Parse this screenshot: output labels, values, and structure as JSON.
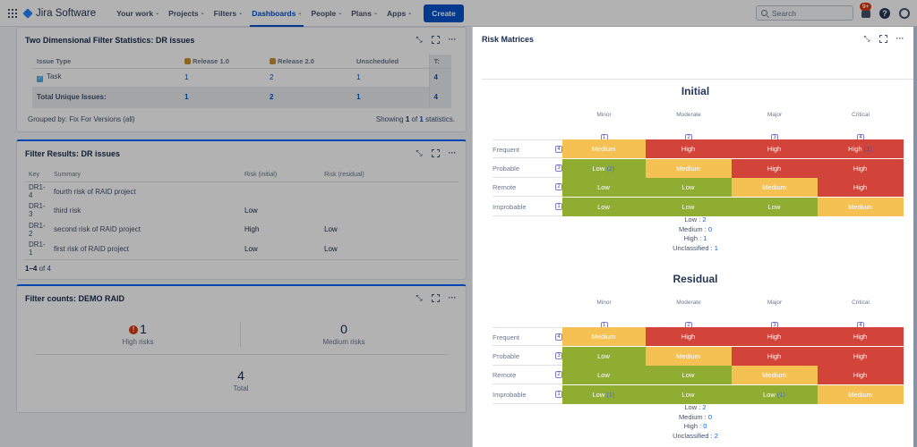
{
  "nav": {
    "app_name": "Jira Software",
    "items": [
      {
        "label": "Your work",
        "active": false
      },
      {
        "label": "Projects",
        "active": false
      },
      {
        "label": "Filters",
        "active": false
      },
      {
        "label": "Dashboards",
        "active": true
      },
      {
        "label": "People",
        "active": false
      },
      {
        "label": "Plans",
        "active": false
      },
      {
        "label": "Apps",
        "active": false
      }
    ],
    "create_label": "Create",
    "search_placeholder": "Search",
    "notifications_badge": "9+",
    "help_label": "?"
  },
  "two_dim": {
    "title": "Two Dimensional Filter Statistics: DR issues",
    "headers": [
      "Issue Type",
      "Release 1.0",
      "Release 2.0",
      "Unscheduled",
      "T:"
    ],
    "row": {
      "type": "Task",
      "values": [
        "1",
        "2",
        "1"
      ],
      "total": "4"
    },
    "total_row": {
      "label": "Total Unique Issues:",
      "values": [
        "1",
        "2",
        "1"
      ],
      "total": "4"
    },
    "grouped_by": "Grouped by: Fix For Versions (all)",
    "showing_prefix": "Showing",
    "showing_current": "1",
    "showing_of": "of",
    "showing_total": "1",
    "showing_suffix": "statistics."
  },
  "filter_results": {
    "title": "Filter Results: DR issues",
    "headers": [
      "Key",
      "Summary",
      "Risk (initial)",
      "Risk (residual)"
    ],
    "rows": [
      {
        "key": "DR1-4",
        "summary": "fourth risk of RAID project",
        "initial": "",
        "residual": ""
      },
      {
        "key": "DR1-3",
        "summary": "third risk",
        "initial": "Low",
        "residual": ""
      },
      {
        "key": "DR1-2",
        "summary": "second risk of RAID project",
        "initial": "High",
        "residual": "Low"
      },
      {
        "key": "DR1-1",
        "summary": "first risk of RAID project",
        "initial": "Low",
        "residual": "Low"
      }
    ],
    "pagination_range": "1–4",
    "pagination_of": "of",
    "pagination_total": "4"
  },
  "filter_counts": {
    "title": "Filter counts: DEMO RAID",
    "high": {
      "value": "1",
      "label": "High risks"
    },
    "medium": {
      "value": "0",
      "label": "Medium risks"
    },
    "total": {
      "value": "4",
      "label": "Total"
    }
  },
  "risk_matrices": {
    "title": "Risk Matrices",
    "columns": [
      {
        "label": "Minor",
        "index": "1"
      },
      {
        "label": "Moderate",
        "index": "2"
      },
      {
        "label": "Major",
        "index": "3"
      },
      {
        "label": "Critical",
        "index": "4"
      }
    ],
    "rows": [
      {
        "label": "Frequent",
        "index": "4"
      },
      {
        "label": "Probable",
        "index": "3"
      },
      {
        "label": "Remote",
        "index": "2"
      },
      {
        "label": "Improbable",
        "index": "1"
      }
    ],
    "matrices": [
      {
        "title": "Initial",
        "cells": [
          [
            {
              "level": "Medium",
              "count": ""
            },
            {
              "level": "High",
              "count": ""
            },
            {
              "level": "High",
              "count": ""
            },
            {
              "level": "High",
              "count": "(1)"
            }
          ],
          [
            {
              "level": "Low",
              "count": "(2)"
            },
            {
              "level": "Medium",
              "count": ""
            },
            {
              "level": "High",
              "count": ""
            },
            {
              "level": "High",
              "count": ""
            }
          ],
          [
            {
              "level": "Low",
              "count": ""
            },
            {
              "level": "Low",
              "count": ""
            },
            {
              "level": "Medium",
              "count": ""
            },
            {
              "level": "High",
              "count": ""
            }
          ],
          [
            {
              "level": "Low",
              "count": ""
            },
            {
              "level": "Low",
              "count": ""
            },
            {
              "level": "Low",
              "count": ""
            },
            {
              "level": "Medium",
              "count": ""
            }
          ]
        ],
        "summary": [
          {
            "label": "Low",
            "value": "2"
          },
          {
            "label": "Medium",
            "value": "0"
          },
          {
            "label": "High",
            "value": "1"
          },
          {
            "label": "Unclassified",
            "value": "1"
          }
        ]
      },
      {
        "title": "Residual",
        "cells": [
          [
            {
              "level": "Medium",
              "count": ""
            },
            {
              "level": "High",
              "count": ""
            },
            {
              "level": "High",
              "count": ""
            },
            {
              "level": "High",
              "count": ""
            }
          ],
          [
            {
              "level": "Low",
              "count": ""
            },
            {
              "level": "Medium",
              "count": ""
            },
            {
              "level": "High",
              "count": ""
            },
            {
              "level": "High",
              "count": ""
            }
          ],
          [
            {
              "level": "Low",
              "count": ""
            },
            {
              "level": "Low",
              "count": ""
            },
            {
              "level": "Medium",
              "count": ""
            },
            {
              "level": "High",
              "count": ""
            }
          ],
          [
            {
              "level": "Low",
              "count": "(1)"
            },
            {
              "level": "Low",
              "count": ""
            },
            {
              "level": "Low",
              "count": "(1)"
            },
            {
              "level": "Medium",
              "count": ""
            }
          ]
        ],
        "summary": [
          {
            "label": "Low",
            "value": "2"
          },
          {
            "label": "Medium",
            "value": "0"
          },
          {
            "label": "High",
            "value": "0"
          },
          {
            "label": "Unclassified",
            "value": "2"
          }
        ]
      }
    ]
  },
  "colors": {
    "low": "#8fad31",
    "medium": "#f5c153",
    "high": "#d2433a",
    "accent": "#0052cc"
  }
}
